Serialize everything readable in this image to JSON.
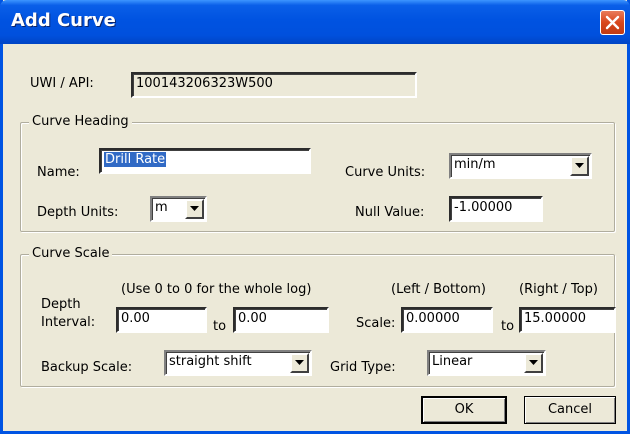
{
  "window": {
    "title": "Add Curve"
  },
  "uwi": {
    "label": "UWI / API:",
    "value": "100143206323W500"
  },
  "curve_heading": {
    "title": "Curve Heading",
    "name_label": "Name:",
    "name_value": "Drill Rate",
    "curve_units_label": "Curve Units:",
    "curve_units_value": "min/m",
    "depth_units_label": "Depth Units:",
    "depth_units_value": "m",
    "null_value_label": "Null Value:",
    "null_value": "-1.00000"
  },
  "curve_scale": {
    "title": "Curve Scale",
    "hint": "(Use 0 to 0 for the whole log)",
    "depth_label_1": "Depth",
    "depth_label_2": "Interval:",
    "depth_from": "0.00",
    "to_1": "to",
    "depth_to": "0.00",
    "left_bottom_label": "(Left / Bottom)",
    "right_top_label": "(Right / Top)",
    "scale_label": "Scale:",
    "scale_left": "0.00000",
    "to_2": "to",
    "scale_right": "15.00000",
    "backup_scale_label": "Backup Scale:",
    "backup_scale_value": "straight shift",
    "grid_type_label": "Grid Type:",
    "grid_type_value": "Linear"
  },
  "buttons": {
    "ok": "OK",
    "cancel": "Cancel"
  },
  "colors": {
    "titlebar": "#0053e1",
    "dialog_bg": "#ece9d8",
    "selection": "#316ac5",
    "close": "#d9471d"
  },
  "icons": {
    "close": "close-x-icon",
    "dropdown": "chevron-down-icon"
  }
}
